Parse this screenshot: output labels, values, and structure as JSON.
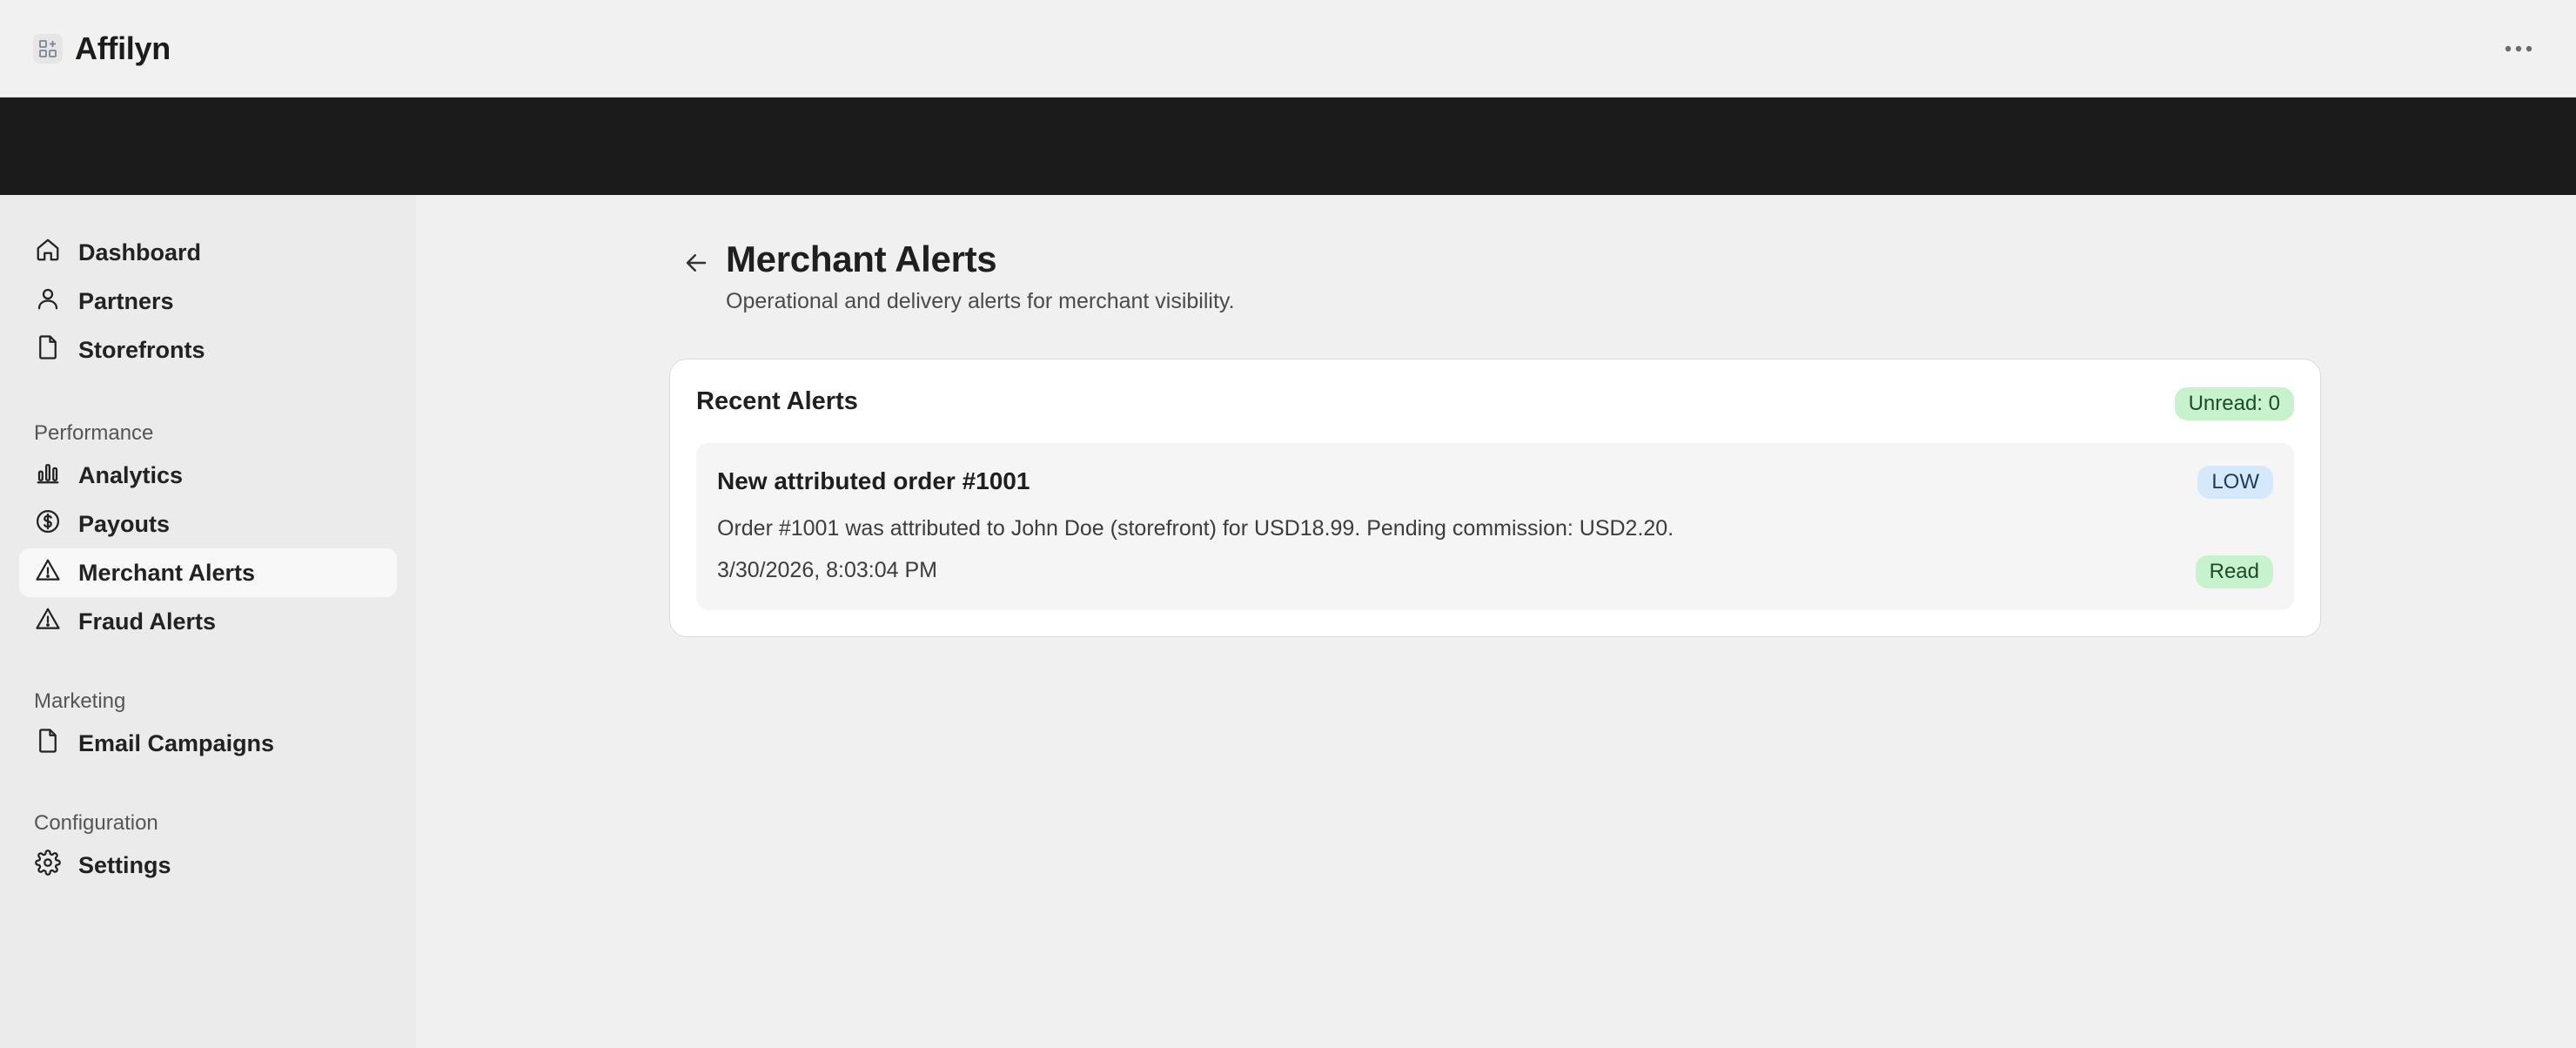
{
  "app": {
    "name": "Affilyn"
  },
  "colors": {
    "band": "#1b1b1b",
    "sidebar_bg": "#ebebeb",
    "badge_green": "#c7f2cd",
    "badge_blue": "#d6e8fb"
  },
  "sidebar": {
    "items_main": [
      {
        "label": "Dashboard",
        "icon": "home-icon"
      },
      {
        "label": "Partners",
        "icon": "user-icon"
      },
      {
        "label": "Storefronts",
        "icon": "file-icon"
      }
    ],
    "sections": [
      {
        "label": "Performance",
        "items": [
          {
            "label": "Analytics",
            "icon": "bar-chart-icon"
          },
          {
            "label": "Payouts",
            "icon": "dollar-circle-icon"
          },
          {
            "label": "Merchant Alerts",
            "icon": "alert-triangle-icon",
            "active": true
          },
          {
            "label": "Fraud Alerts",
            "icon": "alert-triangle-icon"
          }
        ]
      },
      {
        "label": "Marketing",
        "items": [
          {
            "label": "Email Campaigns",
            "icon": "file-icon"
          }
        ]
      },
      {
        "label": "Configuration",
        "items": [
          {
            "label": "Settings",
            "icon": "gear-icon"
          }
        ]
      }
    ]
  },
  "page": {
    "title": "Merchant Alerts",
    "subtitle": "Operational and delivery alerts for merchant visibility."
  },
  "card": {
    "title": "Recent Alerts",
    "unread_badge": "Unread: 0",
    "alerts": [
      {
        "title": "New attributed order #1001",
        "severity": "LOW",
        "body": "Order #1001 was attributed to John Doe (storefront) for USD18.99. Pending commission: USD2.20.",
        "timestamp": "3/30/2026, 8:03:04 PM",
        "status": "Read"
      }
    ]
  }
}
